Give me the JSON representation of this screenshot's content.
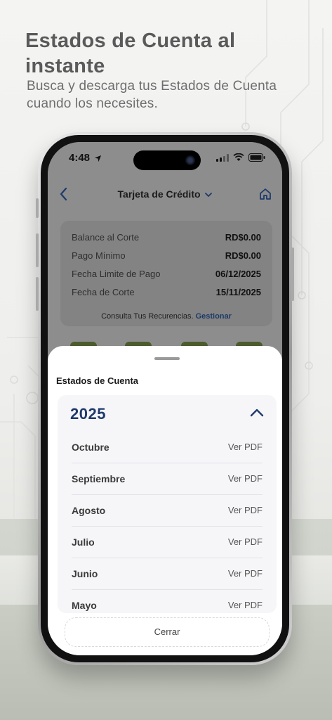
{
  "promo": {
    "headline": "Estados de Cuenta al instante",
    "subhead": "Busca y descarga tus Estados de Cuenta cuando los necesites."
  },
  "status_bar": {
    "time": "4:48"
  },
  "nav": {
    "title": "Tarjeta de Crédito",
    "back_icon": "chevron-left-icon",
    "home_icon": "home-icon"
  },
  "summary": {
    "rows": [
      {
        "label": "Balance al Corte",
        "value": "RD$0.00"
      },
      {
        "label": "Pago Mínimo",
        "value": "RD$0.00"
      },
      {
        "label": "Fecha Limite de Pago",
        "value": "06/12/2025"
      },
      {
        "label": "Fecha de Corte",
        "value": "15/11/2025"
      }
    ],
    "recurrences_text": "Consulta Tus Recurencias.",
    "recurrences_link": "Gestionar"
  },
  "sheet": {
    "title": "Estados de Cuenta",
    "year": "2025",
    "months": [
      {
        "name": "Octubre",
        "action": "Ver PDF"
      },
      {
        "name": "Septiembre",
        "action": "Ver PDF"
      },
      {
        "name": "Agosto",
        "action": "Ver PDF"
      },
      {
        "name": "Julio",
        "action": "Ver PDF"
      },
      {
        "name": "Junio",
        "action": "Ver PDF"
      },
      {
        "name": "Mayo",
        "action": "Ver PDF"
      }
    ],
    "close_label": "Cerrar"
  },
  "colors": {
    "accent": "#1f3a6b",
    "link": "#1c3a66",
    "peek_button": "#4b5b2e"
  }
}
